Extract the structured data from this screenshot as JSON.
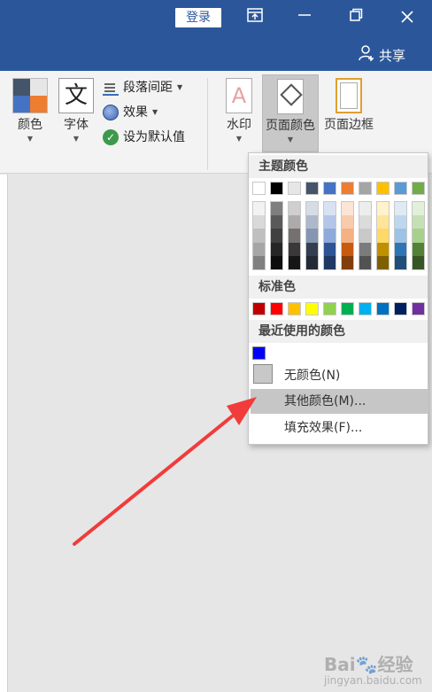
{
  "titlebar": {
    "login_label": "登录",
    "share_label": "共享",
    "icons": [
      "ribbon-display-options-icon",
      "minimize-icon",
      "restore-icon",
      "close-icon",
      "person-add-icon"
    ]
  },
  "ribbon": {
    "colors_label": "颜色",
    "fonts_label": "字体",
    "fonts_glyph": "文",
    "paragraph_spacing_label": "段落间距",
    "effects_label": "效果",
    "set_default_label": "设为默认值",
    "watermark_label": "水印",
    "watermark_glyph": "A",
    "page_color_label": "页面颜色",
    "page_borders_label": "页面边框"
  },
  "dropdown": {
    "theme_colors_header": "主题颜色",
    "theme_colors": [
      [
        "#ffffff",
        "#f2f2f2",
        "#d9d9d9",
        "#bfbfbf",
        "#a6a6a6",
        "#808080"
      ],
      [
        "#000000",
        "#7f7f7f",
        "#595959",
        "#404040",
        "#262626",
        "#0d0d0d"
      ],
      [
        "#e7e6e6",
        "#d0cece",
        "#aeaaaa",
        "#757171",
        "#3a3838",
        "#171616"
      ],
      [
        "#44546a",
        "#d6dce4",
        "#adb9ca",
        "#8496b0",
        "#333f4f",
        "#222a35"
      ],
      [
        "#4472c4",
        "#d9e2f3",
        "#b4c6e7",
        "#8eaadb",
        "#2f5496",
        "#1f3864"
      ],
      [
        "#ed7d31",
        "#fbe5d5",
        "#f7cbac",
        "#f4b183",
        "#c55a11",
        "#833c0b"
      ],
      [
        "#a5a5a5",
        "#ededed",
        "#dbdbdb",
        "#c9c9c9",
        "#7b7b7b",
        "#525252"
      ],
      [
        "#ffc000",
        "#fff2cc",
        "#fee599",
        "#ffd965",
        "#bf9000",
        "#7f6000"
      ],
      [
        "#5b9bd5",
        "#deeaf6",
        "#bdd7ee",
        "#9cc3e5",
        "#2e75b5",
        "#1e4e79"
      ],
      [
        "#70ad47",
        "#e2efd9",
        "#c5e0b3",
        "#a8d08d",
        "#538135",
        "#375623"
      ]
    ],
    "standard_colors_header": "标准色",
    "standard_colors": [
      "#c00000",
      "#ff0000",
      "#ffc000",
      "#ffff00",
      "#92d050",
      "#00b050",
      "#00b0f0",
      "#0070c0",
      "#002060",
      "#7030a0"
    ],
    "recent_colors_header": "最近使用的颜色",
    "recent_colors": [
      "#0000ff"
    ],
    "no_color_label": "无颜色(N)",
    "more_colors_label": "其他颜色(M)...",
    "fill_effects_label": "填充效果(F)..."
  },
  "watermark": {
    "brand": "Bai",
    "brand_suffix": "经验",
    "url": "jingyan.baidu.com"
  }
}
